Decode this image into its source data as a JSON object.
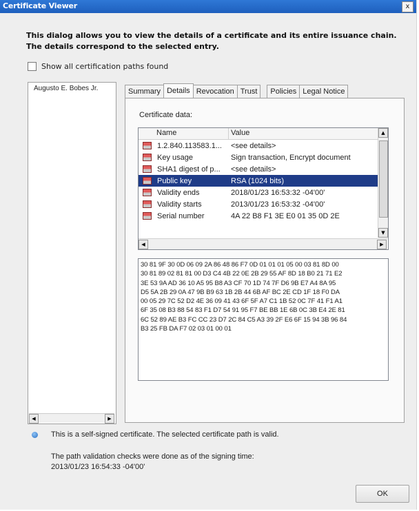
{
  "window": {
    "title": "Certificate Viewer",
    "close_glyph": "x"
  },
  "intro_text": "This dialog allows you to view the details of a certificate and its entire issuance chain. The details correspond to the selected entry.",
  "show_all_paths": {
    "label": "Show all certification paths found",
    "checked": false
  },
  "chain": {
    "items": [
      "Augusto E. Bobes Jr."
    ]
  },
  "tabs": [
    {
      "label": "Summary",
      "active": false
    },
    {
      "label": "Details",
      "active": true
    },
    {
      "label": "Revocation",
      "active": false
    },
    {
      "label": "Trust",
      "active": false
    },
    {
      "label": "Policies",
      "active": false
    },
    {
      "label": "Legal Notice",
      "active": false
    }
  ],
  "details": {
    "certificate_data_label": "Certificate data:",
    "columns": {
      "name": "Name",
      "value": "Value"
    },
    "rows": [
      {
        "name": "1.2.840.113583.1...",
        "value": "<see details>",
        "selected": false
      },
      {
        "name": "Key usage",
        "value": "Sign transaction, Encrypt document",
        "selected": false
      },
      {
        "name": "SHA1 digest of p...",
        "value": "<see details>",
        "selected": false
      },
      {
        "name": "Public key",
        "value": "RSA (1024 bits)",
        "selected": true
      },
      {
        "name": "Validity ends",
        "value": "2018/01/23 16:53:32 -04'00'",
        "selected": false
      },
      {
        "name": "Validity starts",
        "value": "2013/01/23 16:53:32 -04'00'",
        "selected": false
      },
      {
        "name": "Serial number",
        "value": "4A 22 B8 F1 3E E0 01 35 0D 2E",
        "selected": false
      }
    ],
    "hex_lines": [
      "30 81 9F 30 0D 06 09 2A 86 48 86 F7 0D 01 01 01 05 00 03 81 8D 00",
      "30 81 89 02 81 81 00 D3 C4 4B 22 0E 2B 29 55 AF 8D 18 B0 21 71 E2",
      "3E 53 9A AD 36 10 A5 95 B8 A3 CF 70 1D 74 7F D6 9B E7 A4 8A 95",
      "D5 5A 2B 29 0A 47 9B B9 63 1B 2B 44 6B AF BC 2E CD 1F 18 F0 DA",
      "00 05 29 7C 52 D2 4E 36 09 41 43 6F 5F A7 C1 1B 52 0C 7F 41 F1 A1",
      "6F 35 08 B3 88 54 83 F1 D7 54 91 95 F7 BE BB 1E 6B 0C 3B E4 2E 81",
      "6C 52 89 AE B3 FC CC 23 D7 2C 84 C5 A3 39 2F E6 6F 15 94 3B 96 84",
      "B3 25 FB DA F7 02 03 01 00 01"
    ]
  },
  "status": {
    "self_signed": "This is a self-signed certificate. The selected certificate path is valid.",
    "validation_line1": "The path validation checks were done as of the signing time:",
    "validation_line2": "2013/01/23 16:54:33 -04'00'"
  },
  "buttons": {
    "ok": "OK"
  },
  "colors": {
    "titlebar": "#1e5fbd",
    "selection": "#1f3c88",
    "dialog_bg": "#eeeeee"
  },
  "icons": {
    "row_icon": "certificate-field-icon",
    "info": "info-icon",
    "scroll_up": "▲",
    "scroll_down": "▼",
    "scroll_left": "◀",
    "scroll_right": "▶"
  }
}
